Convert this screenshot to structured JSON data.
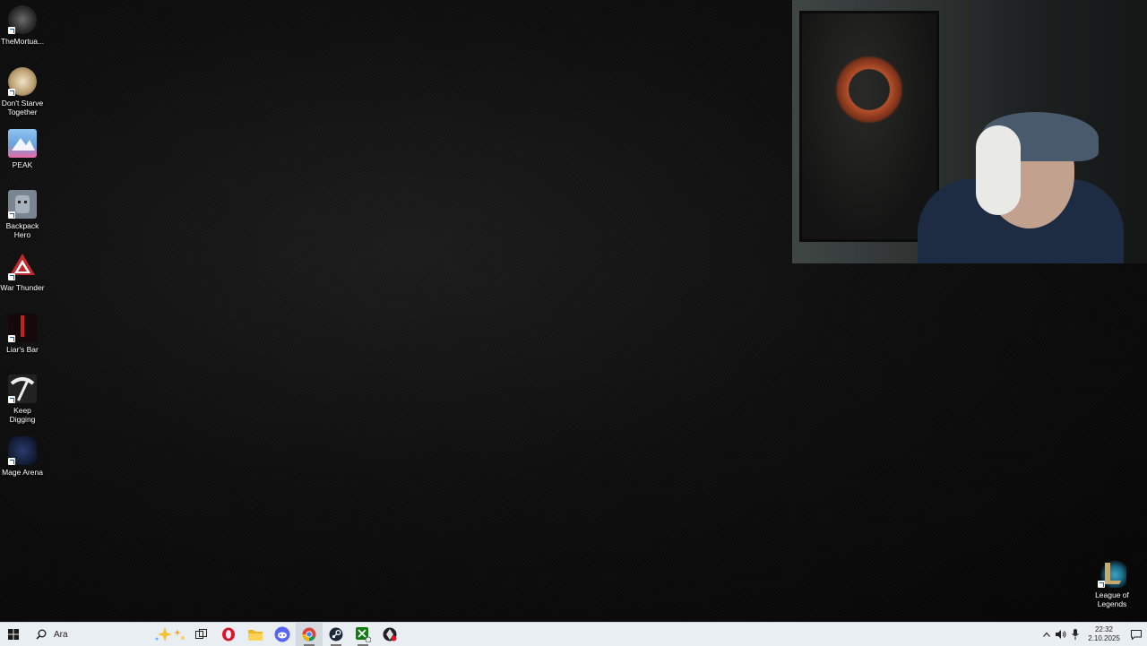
{
  "desktop": {
    "icons": [
      {
        "label": "TheMortua...",
        "icon": "mortuary-assistant-icon",
        "color": "#3a3a3a"
      },
      {
        "label": "Don't Starve Together",
        "icon": "dont-starve-icon",
        "color": "#d9c9a3"
      },
      {
        "label": "PEAK",
        "icon": "peak-icon",
        "color": "#7bb3e6"
      },
      {
        "label": "Backpack Hero",
        "icon": "backpack-hero-icon",
        "color": "#8e98a6"
      },
      {
        "label": "War Thunder",
        "icon": "war-thunder-icon",
        "color": "#c0282d"
      },
      {
        "label": "Liar's Bar",
        "icon": "liars-bar-icon",
        "color": "#1a0b0b"
      },
      {
        "label": "Keep Digging",
        "icon": "keep-digging-icon",
        "color": "#d8d8d8"
      },
      {
        "label": "Mage Arena",
        "icon": "mage-arena-icon",
        "color": "#1c2440"
      }
    ],
    "right_icon": {
      "label": "League of Legends",
      "icon": "league-of-legends-icon",
      "color": "#c8aa6e"
    }
  },
  "webcam": {
    "label": "webcam overlay"
  },
  "taskbar": {
    "search_placeholder": "Ara",
    "pinned": [
      "windows-start-icon",
      "task-view-icon",
      "opera-icon",
      "file-explorer-icon",
      "discord-icon",
      "chrome-icon",
      "steam-icon",
      "xbox-icon",
      "game-app-icon"
    ],
    "time": "22:32",
    "date": "2.10.2025"
  }
}
